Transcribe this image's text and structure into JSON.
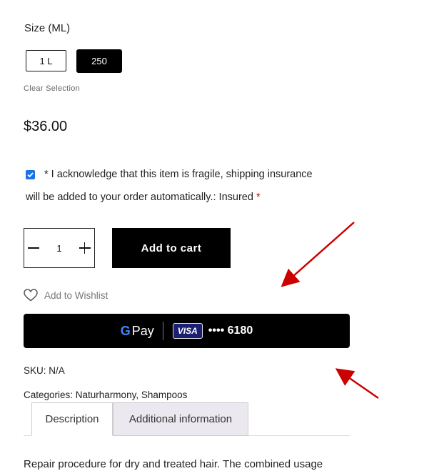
{
  "size": {
    "label": "Size (ML)",
    "options": [
      "1 L",
      "250"
    ],
    "selected": "250",
    "clear_label": "Clear Selection"
  },
  "price": "$36.00",
  "acknowledge": {
    "checked": true,
    "line1": "* I acknowledge that this item is fragile, shipping insurance",
    "line2": "will be added to your order automatically.: Insured",
    "required_mark": "*"
  },
  "quantity": {
    "value": "1"
  },
  "add_to_cart_label": "Add to cart",
  "wishlist_label": "Add to Wishlist",
  "gpay": {
    "g": "G",
    "pay": "Pay",
    "card_brand": "VISA",
    "card_number": "•••• 6180"
  },
  "sku": "SKU: N/A",
  "categories": "Categories: Naturharmony, Shampoos",
  "tabs": [
    "Description",
    "Additional information"
  ],
  "description_text": "Repair procedure for dry and treated hair. The combined usage",
  "colors": {
    "accent": "#1a73e8",
    "annotation_arrow": "#cc0000",
    "tab_inactive_bg": "#ebe9ef"
  }
}
